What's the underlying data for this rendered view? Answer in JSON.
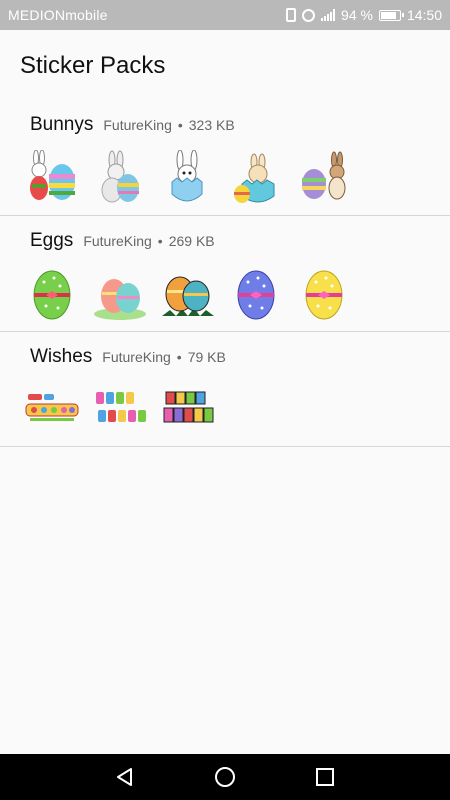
{
  "status_bar": {
    "carrier": "MEDIONmobile",
    "battery": "94 %",
    "battery_level": 0.94,
    "time": "14:50",
    "icons": [
      "vibrate-icon",
      "alarm-icon",
      "signal-icon",
      "battery-icon"
    ]
  },
  "header": {
    "title": "Sticker Packs"
  },
  "packs": [
    {
      "name": "Bunnys",
      "publisher": "FutureKing",
      "separator": "•",
      "size": "323 KB",
      "stickers": [
        "bunny-with-egg",
        "bunny-holding-egg",
        "bunny-in-eggshell",
        "chick-in-egg",
        "bunny-beside-egg"
      ]
    },
    {
      "name": "Eggs",
      "publisher": "FutureKing",
      "separator": "•",
      "size": "269 KB",
      "stickers": [
        "green-polka-egg",
        "egg-pair-basket",
        "egg-pair-grass",
        "blue-polka-egg",
        "yellow-polka-egg"
      ]
    },
    {
      "name": "Wishes",
      "publisher": "FutureKing",
      "separator": "•",
      "size": "79 KB",
      "stickers": [
        "happy-easter-text-1",
        "happy-easter-text-2",
        "happy-easter-text-3"
      ]
    }
  ],
  "nav_bar": {
    "buttons": [
      "back-icon",
      "home-icon",
      "recents-icon"
    ]
  },
  "colors": {
    "status_bar_bg": "#b9b9b9",
    "page_bg": "#fafafa",
    "divider": "#d7d7d7",
    "nav_bar_bg": "#000000"
  }
}
